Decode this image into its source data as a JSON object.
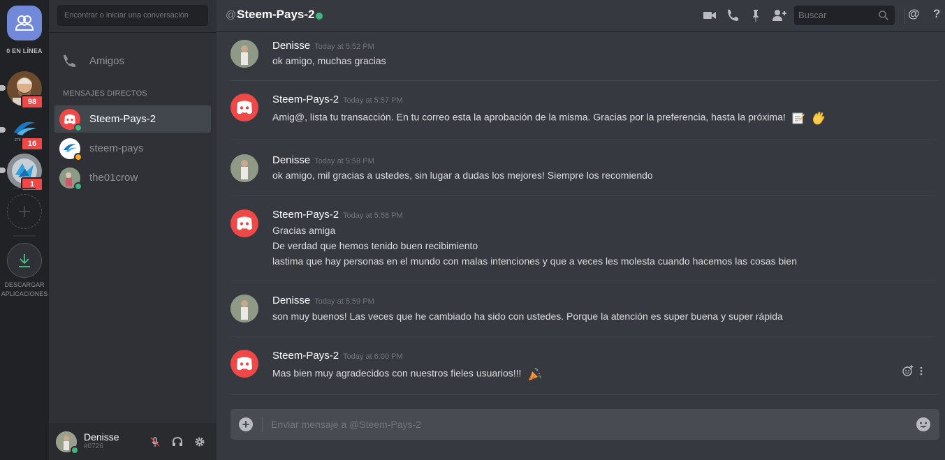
{
  "rail": {
    "online_label": "0 EN LÍNEA",
    "servers": [
      {
        "badge": "98"
      },
      {
        "badge": "16",
        "logo_text": "STEEMPAYS"
      },
      {
        "badge": "1"
      }
    ],
    "download_label_line1": "DESCARGAR",
    "download_label_line2": "APLICACIONES"
  },
  "sidebar": {
    "search_placeholder": "Encontrar o iniciar una conversación",
    "friends_label": "Amigos",
    "dm_header": "MENSAJES DIRECTOS",
    "dms": [
      {
        "name": "Steem-Pays-2",
        "status": "online",
        "active": true
      },
      {
        "name": "steem-pays",
        "status": "idle",
        "active": false
      },
      {
        "name": "the01crow",
        "status": "online",
        "active": false
      }
    ],
    "user": {
      "name": "Denisse",
      "tag": "#0726"
    }
  },
  "header": {
    "at": "@",
    "title": "Steem-Pays-2",
    "search_placeholder": "Buscar",
    "mention_icon": "@",
    "help_icon": "?"
  },
  "messages": [
    {
      "author": "Denisse",
      "time": "Today at 5:52 PM",
      "lines": [
        "ok amigo, muchas gracias"
      ]
    },
    {
      "author": "Steem-Pays-2",
      "time": "Today at 5:57 PM",
      "lines": [
        "Amig@, lista tu transacción. En tu correo esta la aprobación de la misma. Gracias por la preferencia, hasta la próxima!"
      ],
      "emojis": [
        "memo",
        "waving-hand"
      ]
    },
    {
      "author": "Denisse",
      "time": "Today at 5:58 PM",
      "lines": [
        "ok amigo, mil gracias a ustedes, sin lugar a dudas los mejores! Siempre los recomiendo"
      ]
    },
    {
      "author": "Steem-Pays-2",
      "time": "Today at 5:58 PM",
      "lines": [
        "Gracias amiga",
        "De verdad que hemos tenido buen recibimiento",
        "lastima que hay personas en el mundo con malas intenciones y que a veces les molesta cuando hacemos las cosas bien"
      ]
    },
    {
      "author": "Denisse",
      "time": "Today at 5:59 PM",
      "lines": [
        "son muy buenos! Las veces que he cambiado ha sido con ustedes. Porque la atención es super buena y super rápida"
      ]
    },
    {
      "author": "Steem-Pays-2",
      "time": "Today at 6:00 PM",
      "lines": [
        "Mas bien muy agradecidos con nuestros fieles usuarios!!!"
      ],
      "emojis": [
        "party-popper"
      ]
    }
  ],
  "composer": {
    "placeholder": "Enviar mensaje a @Steem-Pays-2"
  },
  "colors": {
    "blurple": "#7289da",
    "online": "#43b581",
    "idle": "#faa61a",
    "badge": "#f04747",
    "discord_red": "#f04747"
  }
}
